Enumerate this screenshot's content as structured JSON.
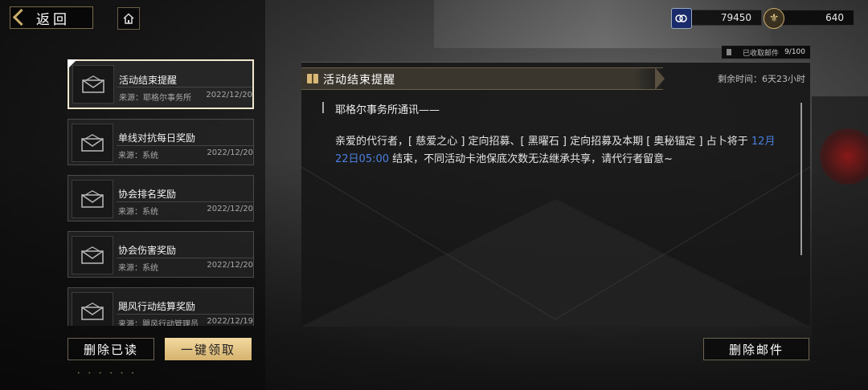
{
  "header": {
    "back_label": "返回",
    "resources": [
      {
        "icon": "ticket-icon",
        "value": "79450"
      },
      {
        "icon": "fleur-coin-icon",
        "value": "640"
      }
    ]
  },
  "mailbox": {
    "received_label": "已收取邮件",
    "received_count": "9/100"
  },
  "mails": [
    {
      "title": "活动结束提醒",
      "source": "来源：耶格尔事务所",
      "date": "2022/12/20",
      "selected": true
    },
    {
      "title": "单线对抗每日奖励",
      "source": "来源：系统",
      "date": "2022/12/20"
    },
    {
      "title": "协会排名奖励",
      "source": "来源：系统",
      "date": "2022/12/20"
    },
    {
      "title": "协会伤害奖励",
      "source": "来源：系统",
      "date": "2022/12/20"
    },
    {
      "title": "飓风行动结算奖励",
      "source": "来源：飓风行动管理员",
      "date": "2022/12/19"
    }
  ],
  "detail": {
    "title": "活动结束提醒",
    "remaining": "剩余时间：6天23小时",
    "sender": "耶格尔事务所通讯——",
    "body_pre": "亲爱的代行者，[ 慈爱之心 ] 定向招募、[ 黑曜石 ] 定向招募及本期 [ 奥秘锚定 ] 占卜将于",
    "body_highlight": "12月22日05:00",
    "body_post": "结束，不同活动卡池保底次数无法继承共享，请代行者留意~",
    "highlight_color": "#4a7fe0"
  },
  "buttons": {
    "delete_read": "删除已读",
    "claim_all": "一键领取",
    "delete_mail": "删除邮件"
  }
}
